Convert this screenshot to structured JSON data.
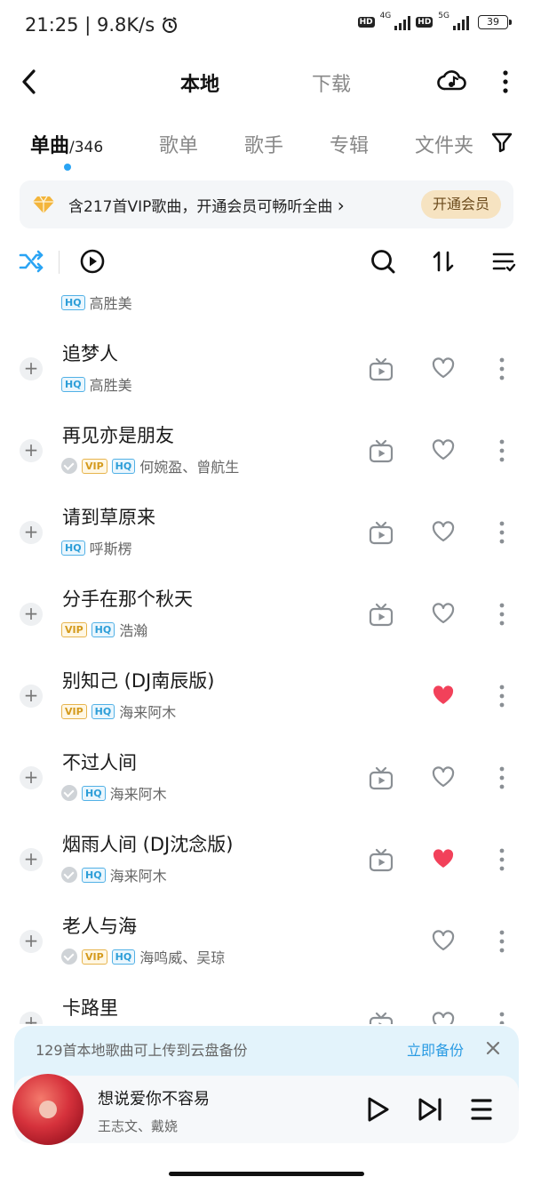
{
  "status_bar": {
    "time": "21:25",
    "speed": "9.8K/s",
    "net1": "4G",
    "net2": "5G",
    "hd": "HD",
    "battery": "39"
  },
  "header": {
    "tab_local": "本地",
    "tab_download": "下载"
  },
  "categories": {
    "songs_label": "单曲",
    "songs_count": "/346",
    "playlists": "歌单",
    "singers": "歌手",
    "albums": "专辑",
    "folders": "文件夹"
  },
  "vip_banner": {
    "text": "含217首VIP歌曲，开通会员可畅听全曲",
    "chevron": "›",
    "button": "开通会员"
  },
  "badges": {
    "vip": "VIP",
    "hq": "HQ"
  },
  "songs": [
    {
      "title": "",
      "artist": "高胜美",
      "downloaded": false,
      "vip": false,
      "hq": true,
      "mv": false,
      "liked": false
    },
    {
      "title": "追梦人",
      "artist": "高胜美",
      "downloaded": false,
      "vip": false,
      "hq": true,
      "mv": true,
      "liked": false
    },
    {
      "title": "再见亦是朋友",
      "artist": "何婉盈、曾航生",
      "downloaded": true,
      "vip": true,
      "hq": true,
      "mv": true,
      "liked": false
    },
    {
      "title": "请到草原来",
      "artist": "呼斯楞",
      "downloaded": false,
      "vip": false,
      "hq": true,
      "mv": true,
      "liked": false
    },
    {
      "title": "分手在那个秋天",
      "artist": "浩瀚",
      "downloaded": false,
      "vip": true,
      "hq": true,
      "mv": true,
      "liked": false
    },
    {
      "title": "别知己 (DJ南辰版)",
      "artist": "海来阿木",
      "downloaded": false,
      "vip": true,
      "hq": true,
      "mv": false,
      "liked": true
    },
    {
      "title": "不过人间",
      "artist": "海来阿木",
      "downloaded": true,
      "vip": false,
      "hq": true,
      "mv": true,
      "liked": false
    },
    {
      "title": "烟雨人间 (DJ沈念版)",
      "artist": "海来阿木",
      "downloaded": true,
      "vip": false,
      "hq": true,
      "mv": true,
      "liked": true
    },
    {
      "title": "老人与海",
      "artist": "海鸣威、吴琼",
      "downloaded": true,
      "vip": true,
      "hq": true,
      "mv": false,
      "liked": false
    },
    {
      "title": "卡路里",
      "artist": "",
      "downloaded": false,
      "vip": false,
      "hq": false,
      "mv": true,
      "liked": false
    }
  ],
  "backup_banner": {
    "text": "129首本地歌曲可上传到云盘备份",
    "action": "立即备份"
  },
  "player": {
    "title": "想说爱你不容易",
    "artist": "王志文、戴娆"
  },
  "colors": {
    "accent_blue": "#2aa4f4",
    "liked_red": "#f2415a",
    "vip_gold": "#d49a1c",
    "hq_blue": "#2d9ed8"
  }
}
